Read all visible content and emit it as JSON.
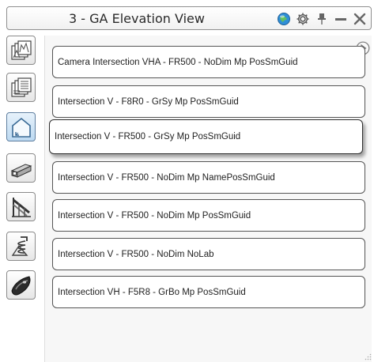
{
  "window": {
    "title": "3 - GA Elevation View",
    "title_icons": [
      "globe-icon",
      "gear-icon",
      "pin-icon",
      "minimize-icon",
      "close-icon"
    ]
  },
  "toolbar": {
    "tools": [
      "view-stack-icon",
      "view-list-icon",
      "house-elevation-icon",
      "beam-profile-icon",
      "stair-rail-icon",
      "spring-icon",
      "dark-shape-icon"
    ],
    "active_tool": "house-elevation-icon"
  },
  "list": {
    "items": [
      {
        "label": "Camera Intersection VHA - FR500 - NoDim Mp PosSmGuid"
      },
      {
        "label": "Intersection V - F8R0 - GrSy Mp PosSmGuid"
      },
      {
        "label": "Intersection V - FR500 - GrSy Mp PosSmGuid"
      },
      {
        "label": "Intersection V - FR500 - NoDim Mp NamePosSmGuid"
      },
      {
        "label": "Intersection V - FR500 - NoDim Mp PosSmGuid"
      },
      {
        "label": "Intersection V - FR500 - NoDim NoLab"
      },
      {
        "label": "Intersection VH - F5R8 - GrBo Mp PosSmGuid"
      }
    ],
    "selected_index": 2
  },
  "colors": {
    "accent": "#3a8fd0",
    "globe": "#2f8fd8"
  }
}
